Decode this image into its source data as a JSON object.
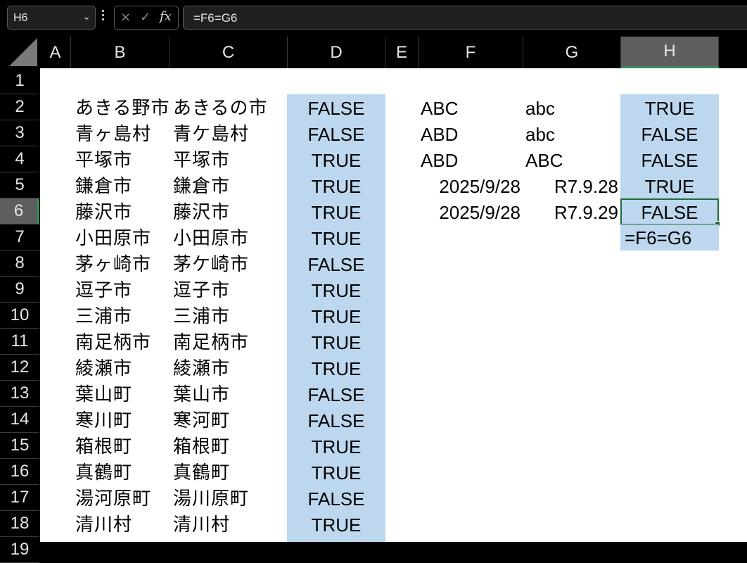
{
  "name_box": {
    "value": "H6"
  },
  "formula_bar": {
    "value": "=F6=G6",
    "cancel_icon": "×",
    "enter_icon": "✓",
    "fx_label": "fx"
  },
  "columns": [
    "A",
    "B",
    "C",
    "D",
    "E",
    "F",
    "G",
    "H"
  ],
  "selected_column": "H",
  "rows": [
    "1",
    "2",
    "3",
    "4",
    "5",
    "6",
    "7",
    "8",
    "9",
    "10",
    "11",
    "12",
    "13",
    "14",
    "15",
    "16",
    "17",
    "18",
    "19"
  ],
  "selected_row": "6",
  "sheet": {
    "col_b": [
      "あきる野市",
      "青ヶ島村",
      "平塚市",
      "鎌倉市",
      "藤沢市",
      "小田原市",
      "茅ヶ崎市",
      "逗子市",
      "三浦市",
      "南足柄市",
      "綾瀬市",
      "葉山町",
      "寒川町",
      "箱根町",
      "真鶴町",
      "湯河原町",
      "清川村"
    ],
    "col_c": [
      "あきるの市",
      "青ケ島村",
      "平塚市",
      "鎌倉市",
      "藤沢市",
      "小田原市",
      "茅ケ崎市",
      "逗子市",
      "三浦市",
      "南足柄市",
      "綾瀬市",
      "葉山市",
      "寒河町",
      "箱根町",
      "真鶴町",
      "湯川原町",
      "清川村"
    ],
    "col_d": [
      "FALSE",
      "FALSE",
      "TRUE",
      "TRUE",
      "TRUE",
      "TRUE",
      "FALSE",
      "TRUE",
      "TRUE",
      "TRUE",
      "TRUE",
      "FALSE",
      "FALSE",
      "TRUE",
      "TRUE",
      "FALSE",
      "TRUE"
    ],
    "col_f": [
      "ABC",
      "ABD",
      "ABD",
      "2025/9/28",
      "2025/9/28"
    ],
    "col_g": [
      "abc",
      "abc",
      "ABC",
      "R7.9.28",
      "R7.9.29"
    ],
    "col_h": [
      "TRUE",
      "FALSE",
      "FALSE",
      "TRUE",
      "FALSE"
    ],
    "h7_editing": "=F6=G6"
  },
  "colors": {
    "fill": "#bdd7ee",
    "selection_border": "#1e6b3c"
  }
}
